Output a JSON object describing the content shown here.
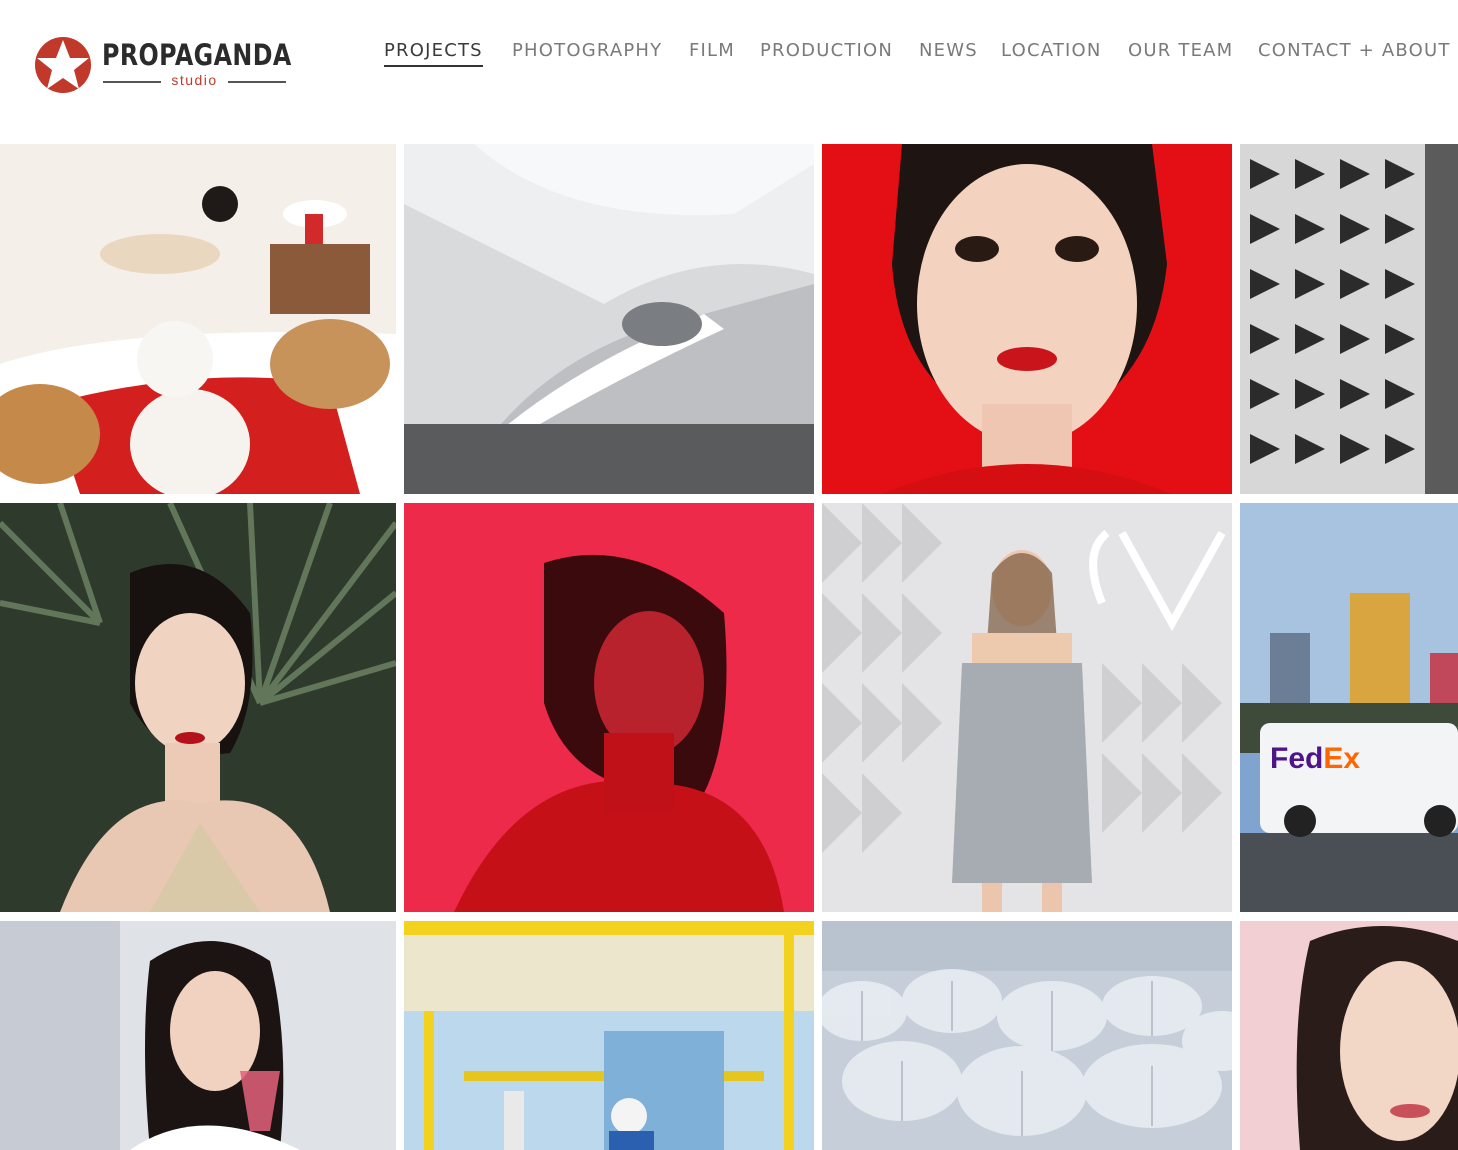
{
  "brand": {
    "name": "PROPAGANDA",
    "tagline": "studio",
    "accent": "#c0392b"
  },
  "nav": {
    "items": [
      {
        "label": "PROJECTS",
        "active": true
      },
      {
        "label": "PHOTOGRAPHY",
        "active": false
      },
      {
        "label": "FILM",
        "active": false
      },
      {
        "label": "PRODUCTION",
        "active": false
      },
      {
        "label": "NEWS",
        "active": false
      },
      {
        "label": "LOCATION",
        "active": false
      },
      {
        "label": "OUR TEAM",
        "active": false
      },
      {
        "label": "CONTACT + ABOUT",
        "active": false
      }
    ]
  },
  "gallery": {
    "tiles": [
      {
        "subject": "woman-on-bed-with-dogs"
      },
      {
        "subject": "white-futuristic-interior"
      },
      {
        "subject": "portrait-red-background"
      },
      {
        "subject": "building-facade-pattern"
      },
      {
        "subject": "woman-with-palm-leaves-lipstick"
      },
      {
        "subject": "woman-in-red-light"
      },
      {
        "subject": "woman-in-silver-dress-valentino"
      },
      {
        "subject": "fedex-van-city-night",
        "visible_text": "FedEx"
      },
      {
        "subject": "woman-drinking"
      },
      {
        "subject": "factory-worker-lab"
      },
      {
        "subject": "snowy-forest"
      },
      {
        "subject": "portrait-pink-background"
      }
    ]
  }
}
